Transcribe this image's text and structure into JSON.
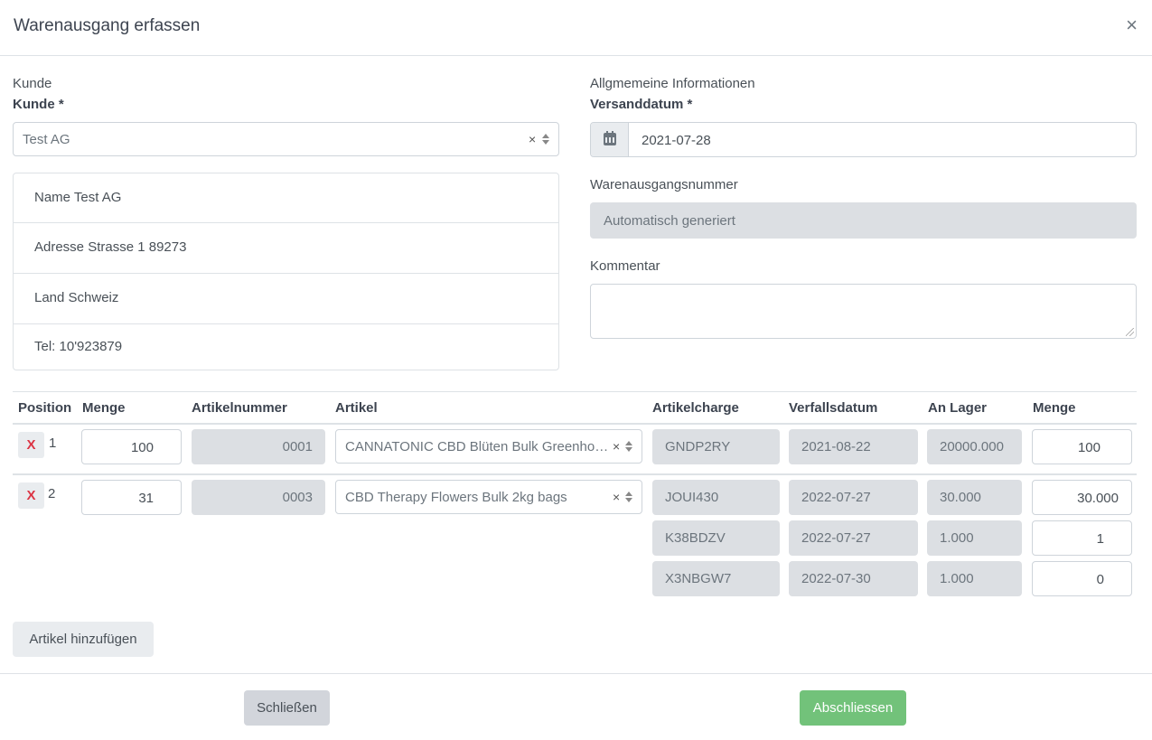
{
  "modal": {
    "title": "Warenausgang erfassen",
    "close_symbol": "×"
  },
  "customer": {
    "section_title": "Kunde",
    "field_label": "Kunde",
    "required_mark": "*",
    "selected": "Test AG",
    "clear_symbol": "×",
    "address_lines": [
      "Name Test AG",
      "Adresse Strasse 1 89273",
      "Land Schweiz",
      "Tel: 10'923879"
    ]
  },
  "general": {
    "section_title": "Allgmemeine Informationen",
    "ship_date_label": "Versanddatum",
    "required_mark": "*",
    "ship_date": "2021-07-28",
    "number_label": "Warenausgangsnummer",
    "number_value": "Automatisch generiert",
    "comment_label": "Kommentar",
    "comment_value": ""
  },
  "table": {
    "headers": [
      "Position",
      "Menge",
      "Artikelnummer",
      "Artikel",
      "Artikelcharge",
      "Verfallsdatum",
      "An Lager",
      "Menge"
    ],
    "delete_symbol": "X",
    "clear_symbol": "×",
    "rows": [
      {
        "position": "1",
        "menge": "100",
        "artikelnummer": "0001",
        "artikel": "CANNATONIC CBD Blüten Bulk Greenhouse",
        "batches": [
          {
            "charge": "GNDP2RY",
            "verfall": "2021-08-22",
            "lager": "20000.000",
            "menge": "100"
          }
        ]
      },
      {
        "position": "2",
        "menge": "31",
        "artikelnummer": "0003",
        "artikel": "CBD Therapy Flowers Bulk 2kg bags",
        "batches": [
          {
            "charge": "JOUI430",
            "verfall": "2022-07-27",
            "lager": "30.000",
            "menge": "30.000"
          },
          {
            "charge": "K38BDZV",
            "verfall": "2022-07-27",
            "lager": "1.000",
            "menge": "1"
          },
          {
            "charge": "X3NBGW7",
            "verfall": "2022-07-30",
            "lager": "1.000",
            "menge": "0"
          }
        ]
      }
    ]
  },
  "actions": {
    "add_item": "Artikel hinzufügen",
    "close": "Schließen",
    "finish": "Abschliessen"
  },
  "colors": {
    "finish_button": "#72c27a",
    "delete_x": "#dc3545",
    "disabled_bg": "#dcdfe3"
  }
}
